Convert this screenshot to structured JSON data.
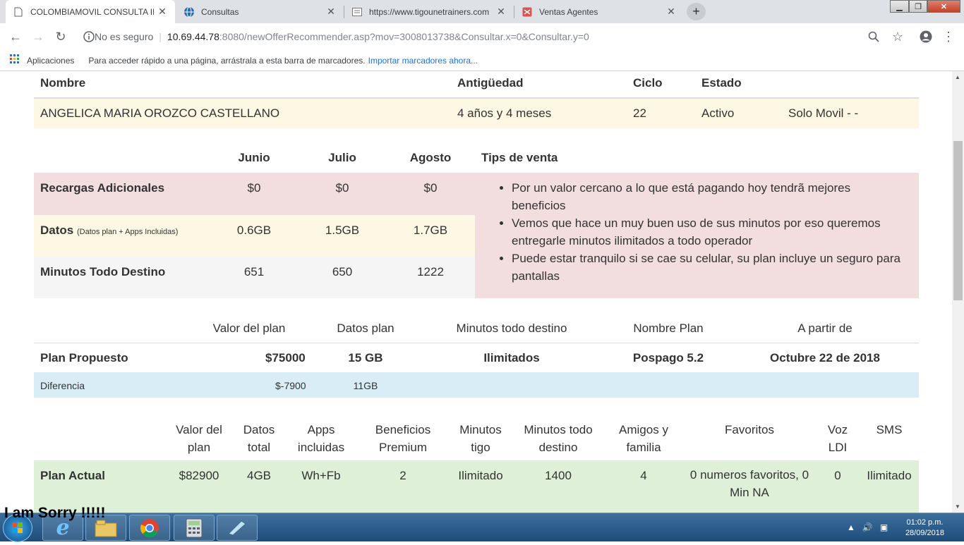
{
  "tabs": [
    {
      "title": "COLOMBIAMOVIL CONSULTA IN",
      "icon": "page-icon"
    },
    {
      "title": "Consultas",
      "icon": "globe-icon"
    },
    {
      "title": "https://www.tigounetrainers.com",
      "icon": "page-icon"
    },
    {
      "title": "Ventas Agentes",
      "icon": "calendar-icon"
    }
  ],
  "address": {
    "insecure_label": "No es seguro",
    "host": "10.69.44.78",
    "rest": ":8080/newOfferRecommender.asp?mov=3008013738&Consultar.x=0&Consultar.y=0"
  },
  "bookmarks": {
    "apps_label": "Aplicaciones",
    "hint": "Para acceder rápido a una página, arrástrala a esta barra de marcadores.",
    "import_link": "Importar marcadores ahora..."
  },
  "client": {
    "headers": {
      "name": "Nombre",
      "age": "Antigüedad",
      "cycle": "Ciclo",
      "status": "Estado"
    },
    "name": "ANGELICA MARIA OROZCO CASTELLANO",
    "age": "4 años y 4 meses",
    "cycle": "22",
    "status": "Activo",
    "type": "Solo Movil - -"
  },
  "usage": {
    "months": [
      "Junio",
      "Julio",
      "Agosto"
    ],
    "tips_header": "Tips de venta",
    "rows": [
      {
        "label": "Recargas Adicionales",
        "note": "",
        "values": [
          "$0",
          "$0",
          "$0"
        ]
      },
      {
        "label": "Datos",
        "note": "(Datos plan + Apps Incluidas)",
        "values": [
          "0.6GB",
          "1.5GB",
          "1.7GB"
        ]
      },
      {
        "label": "Minutos Todo Destino",
        "note": "",
        "values": [
          "651",
          "650",
          "1222"
        ]
      }
    ],
    "tips": [
      "Por un valor cercano a lo que está pagando hoy tendrã mejores beneficios",
      "Vemos que hace un muy buen uso de sus minutos por eso queremos entregarle minutos ilimitados a todo operador",
      "Puede estar tranquilo si se cae su celular, su plan incluye un seguro para pantallas"
    ]
  },
  "proposed": {
    "headers": {
      "value": "Valor del plan",
      "data": "Datos plan",
      "minutes": "Minutos todo destino",
      "plan_name": "Nombre Plan",
      "from": "A partir de"
    },
    "label": "Plan Propuesto",
    "value": "$75000",
    "data": "15 GB",
    "minutes": "Ilimitados",
    "plan_name": "Pospago 5.2",
    "from": "Octubre 22 de 2018",
    "diff_label": "Diferencia",
    "diff_value": "$-7900",
    "diff_data": "11GB"
  },
  "current": {
    "headers": [
      "Valor del plan",
      "Datos total",
      "Apps incluidas",
      "Beneficios Premium",
      "Minutos tigo",
      "Minutos todo destino",
      "Amigos y familia",
      "Favoritos",
      "Voz LDI",
      "SMS"
    ],
    "label": "Plan Actual",
    "values": [
      "$82900",
      "4GB",
      "Wh+Fb",
      "2",
      "Ilimitado",
      "1400",
      "4",
      "0 numeros favoritos, 0 Min NA",
      "0",
      "Ilimitado"
    ]
  },
  "overlay_text": "I am Sorry !!!!!",
  "clock": {
    "time": "01:02 p.m.",
    "date": "28/09/2018"
  },
  "colors": {
    "cream": "#fcf8e3",
    "pink": "#f2dede",
    "blue": "#d9edf7",
    "green": "#dff0d8"
  }
}
